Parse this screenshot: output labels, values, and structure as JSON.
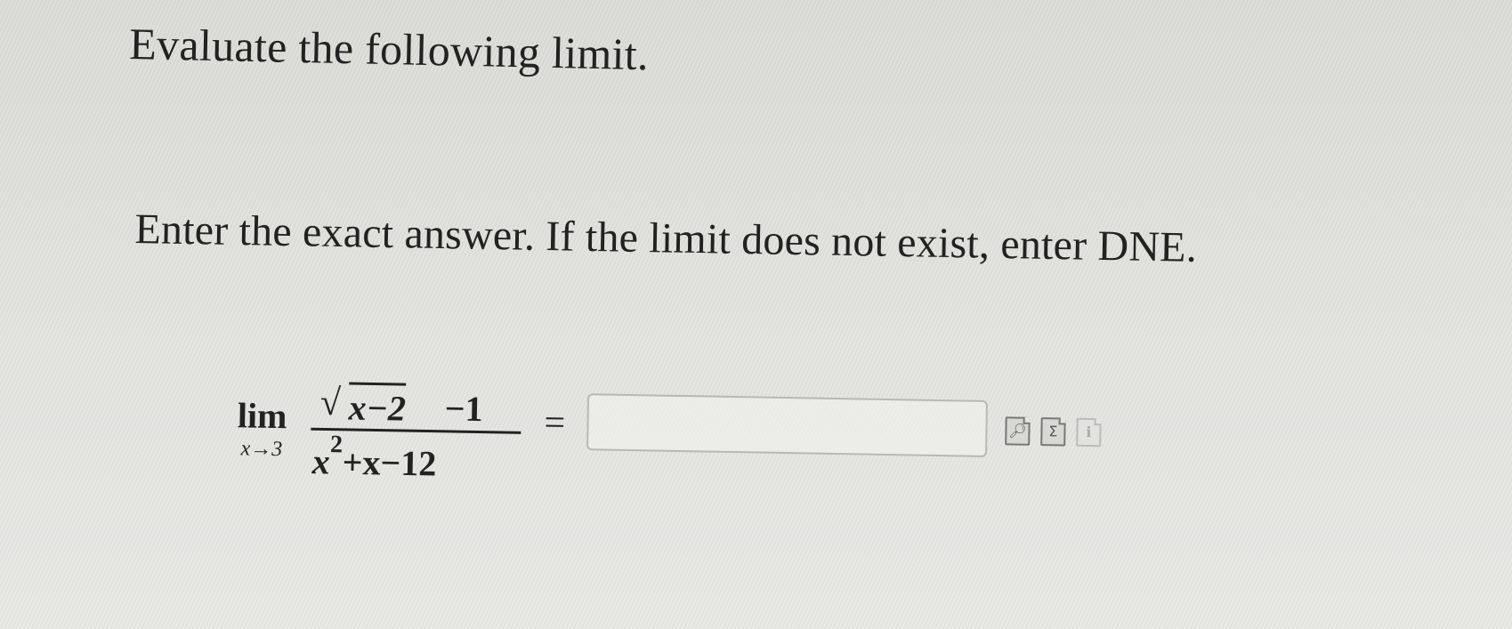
{
  "question": {
    "title": "Evaluate the following limit.",
    "instructions": "Enter the exact answer. If the limit does not exist, enter DNE."
  },
  "expression": {
    "lim_word": "lim",
    "lim_subscript": "x→3",
    "sqrt_symbol": "√",
    "radicand": "x−2",
    "numerator_rest": "−1",
    "denominator_base": "x",
    "denominator_exponent": "2",
    "denominator_rest": "+x−12",
    "equals": "="
  },
  "answer": {
    "value": "",
    "placeholder": ""
  },
  "tools": {
    "preview_icon": "preview-icon",
    "equation_icon": "equation-editor-icon",
    "equation_glyph": "Σ",
    "help_icon": "help-icon"
  }
}
